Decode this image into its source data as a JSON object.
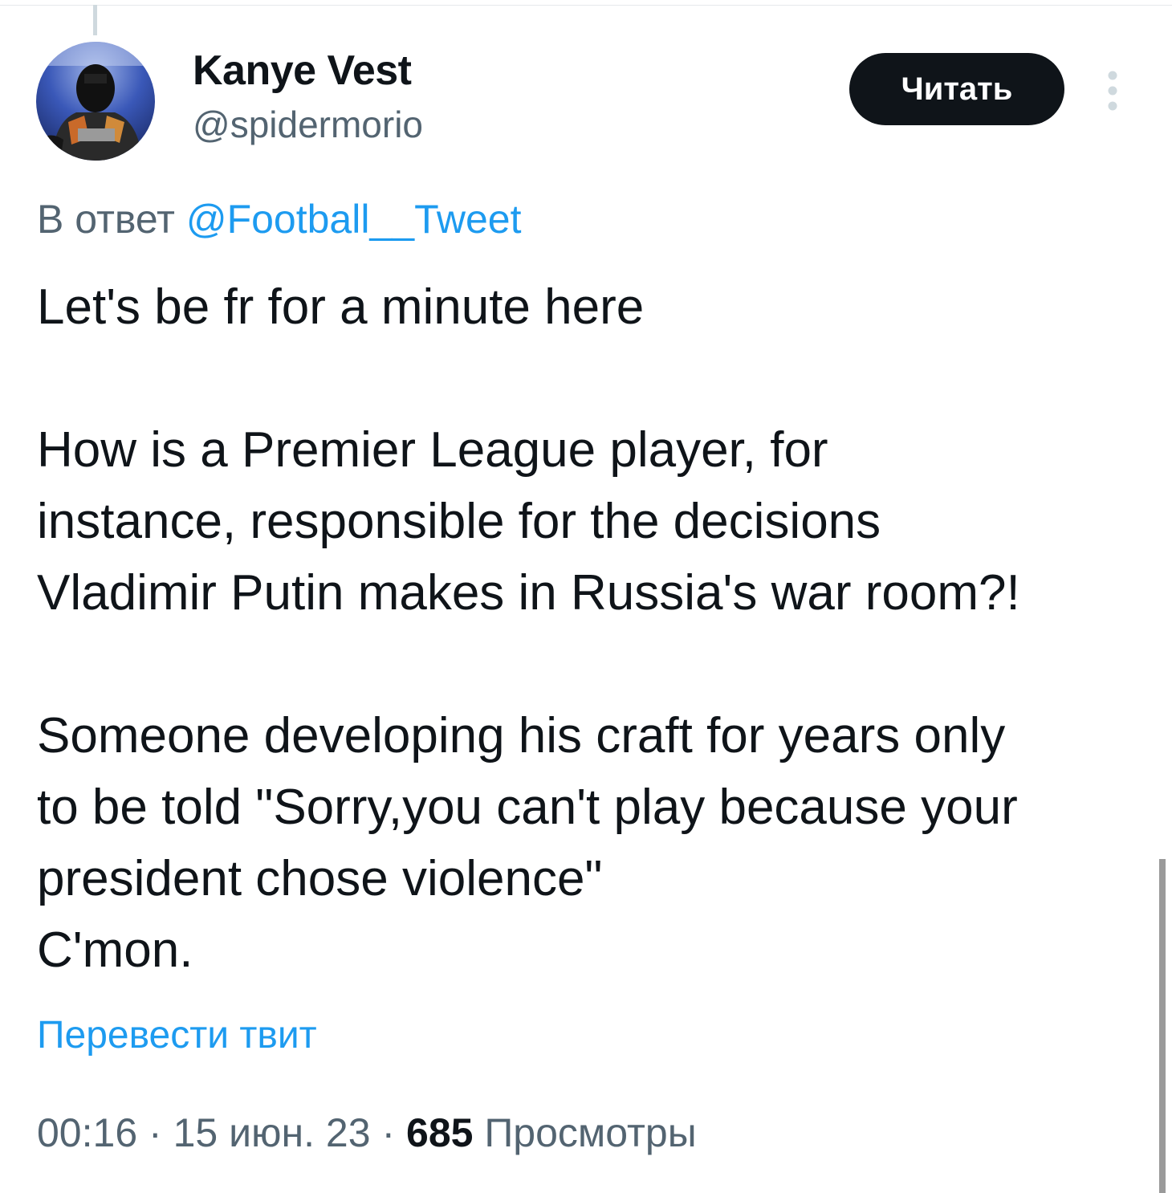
{
  "author": {
    "display_name": "Kanye Vest",
    "handle": "@spidermorio"
  },
  "follow_button": {
    "label": "Читать"
  },
  "more_menu": {
    "icon": "more-vertical-icon"
  },
  "reply_context": {
    "prefix": "В ответ",
    "mention": "@Football__Tweet"
  },
  "tweet": {
    "lines": [
      "Let's be fr for a minute here",
      "How is a Premier League player, for",
      "instance, responsible for the decisions",
      "Vladimir Putin makes in Russia's war room?!",
      "Someone developing his craft for years only",
      "to be told \"Sorry,you can't play because your",
      "president chose violence\"",
      "C'mon."
    ]
  },
  "translate": {
    "label": "Перевести твит"
  },
  "meta": {
    "time": "00:16",
    "separator": "·",
    "date": "15 июн. 23",
    "views_count": "685",
    "views_label": "Просмотры"
  },
  "colors": {
    "text": "#0f1419",
    "secondary": "#536471",
    "link": "#1d9bf0",
    "button_bg": "#0f1419",
    "button_text": "#ffffff"
  }
}
